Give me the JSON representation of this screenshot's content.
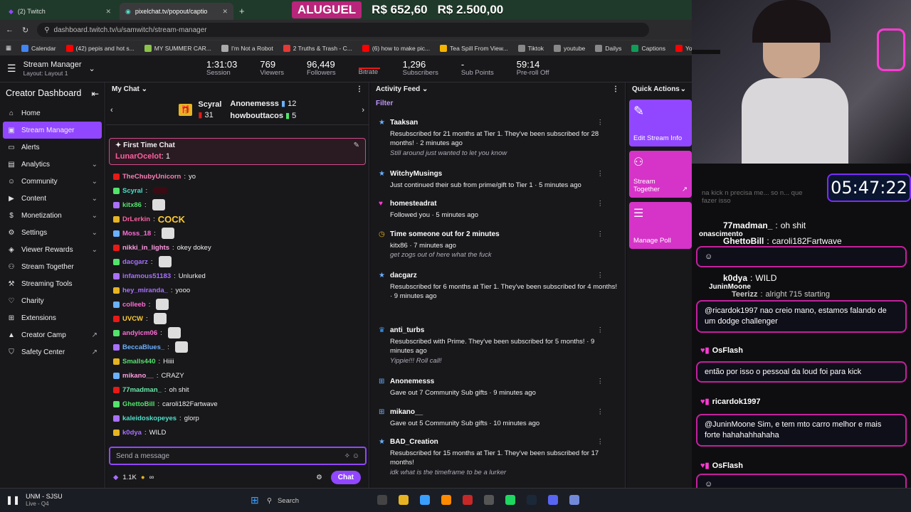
{
  "browser": {
    "tabs": [
      {
        "label": "(2) Twitch"
      },
      {
        "label": "pixelchat.tv/popout/captio"
      }
    ],
    "url": "dashboard.twitch.tv/u/samwitch/stream-manager",
    "bookmarks": [
      "Calendar",
      "(42) pepis and hot s...",
      "MY SUMMER CAR...",
      "I'm Not a Robot",
      "2 Truths & Trash - C...",
      "(6) how to make pic...",
      "Tea Spill From View...",
      "Tiktok",
      "youtube",
      "Dailys",
      "Captions",
      "YouTube"
    ]
  },
  "banner": {
    "tag": "ALUGUEL",
    "price1": "R$ 652,60",
    "price2": "R$ 2.500,00"
  },
  "header": {
    "title": "Stream Manager",
    "layout": "Layout: Layout 1",
    "stats": [
      {
        "value": "1:31:03",
        "label": "Session"
      },
      {
        "value": "769",
        "label": "Viewers"
      },
      {
        "value": "96,449",
        "label": "Followers"
      },
      {
        "value": "",
        "label": "Bitrate"
      },
      {
        "value": "1,296",
        "label": "Subscribers"
      },
      {
        "value": "-",
        "label": "Sub Points"
      },
      {
        "value": "59:14",
        "label": "Pre-roll Off"
      }
    ]
  },
  "sidebar": {
    "title": "Creator Dashboard",
    "items": [
      {
        "label": "Home",
        "icon": "home-icon"
      },
      {
        "label": "Stream Manager",
        "icon": "stream-manager-icon"
      },
      {
        "label": "Alerts",
        "icon": "alerts-icon"
      },
      {
        "label": "Analytics",
        "icon": "analytics-icon"
      },
      {
        "label": "Community",
        "icon": "community-icon"
      },
      {
        "label": "Content",
        "icon": "content-icon"
      },
      {
        "label": "Monetization",
        "icon": "monetization-icon"
      },
      {
        "label": "Settings",
        "icon": "settings-icon"
      },
      {
        "label": "Viewer Rewards",
        "icon": "rewards-icon"
      },
      {
        "label": "Stream Together",
        "icon": "stream-together-icon"
      },
      {
        "label": "Streaming Tools",
        "icon": "tools-icon"
      },
      {
        "label": "Charity",
        "icon": "charity-icon"
      },
      {
        "label": "Extensions",
        "icon": "extensions-icon"
      },
      {
        "label": "Creator Camp",
        "icon": "camp-icon"
      },
      {
        "label": "Safety Center",
        "icon": "shield-icon"
      }
    ]
  },
  "chat": {
    "title": "My Chat",
    "gifters": [
      {
        "name": "Scyral",
        "count": "31"
      },
      {
        "name": "Anonemesss",
        "count": "12"
      },
      {
        "name": "howbouttacos",
        "count": "5"
      }
    ],
    "first_time": {
      "title": "First Time Chat",
      "user": "LunarOcelot",
      "text": "1"
    },
    "messages": [
      {
        "user": "TheChubyUnicorn",
        "color": "#ff7eb6",
        "text": "yo"
      },
      {
        "user": "Scyral",
        "color": "#4ee0c9",
        "text": ""
      },
      {
        "user": "kitx86",
        "color": "#52e36b",
        "text": ""
      },
      {
        "user": "DrLerkin",
        "color": "#ff5ea0",
        "text": "COCK"
      },
      {
        "user": "Moss_18",
        "color": "#ff6ad5",
        "text": ""
      },
      {
        "user": "nikki_in_lights",
        "color": "#ff9be0",
        "text": "okey dokey"
      },
      {
        "user": "dacgarz",
        "color": "#a970ff",
        "text": ""
      },
      {
        "user": "infamous51183",
        "color": "#a970ff",
        "text": "Unlurked"
      },
      {
        "user": "hey_miranda_",
        "color": "#a970ff",
        "text": "yooo"
      },
      {
        "user": "colleeb",
        "color": "#ff6ad5",
        "text": ""
      },
      {
        "user": "UVCW",
        "color": "#ffcc33",
        "text": ""
      },
      {
        "user": "andyicm06",
        "color": "#ff6ad5",
        "text": ""
      },
      {
        "user": "BeccaBlues_",
        "color": "#6ab0ff",
        "text": ""
      },
      {
        "user": "Smalls440",
        "color": "#52e36b",
        "text": "Hiiii"
      },
      {
        "user": "mikano__",
        "color": "#ff9be0",
        "text": "CRAZY"
      },
      {
        "user": "77madman_",
        "color": "#6ae6a8",
        "text": "oh shit"
      },
      {
        "user": "GhettoBill",
        "color": "#52e36b",
        "text": "caroli182Fartwave"
      },
      {
        "user": "kaleidoskopeyes",
        "color": "#4ee0c9",
        "text": "glorp"
      },
      {
        "user": "k0dya",
        "color": "#a970ff",
        "text": "WILD"
      }
    ],
    "input_placeholder": "Send a message",
    "points": "1.1K",
    "infinity": "∞",
    "send_label": "Chat"
  },
  "feed": {
    "title": "Activity Feed",
    "filter": "Filter",
    "items": [
      {
        "user": "Taaksan",
        "line": "Resubscribed for 21 months at Tier 1. They've been subscribed for 28 months! · 2 minutes ago",
        "quote": "Still around just wanted to let you know",
        "icon": "star-icon"
      },
      {
        "user": "WitchyMusings",
        "line": "Just continued their sub from prime/gift to Tier 1 · 5 minutes ago",
        "quote": "",
        "icon": "star-icon"
      },
      {
        "user": "homesteadrat",
        "line": "Followed you · 5 minutes ago",
        "quote": "",
        "icon": "heart-icon"
      },
      {
        "user": "Time someone out for 2 minutes",
        "line": "kitx86 · 7 minutes ago",
        "quote": "get zogs out of here what the fuck",
        "icon": "clock-icon"
      },
      {
        "user": "dacgarz",
        "line": "Resubscribed for 6 months at Tier 1. They've been subscribed for 4 months! · 9 minutes ago",
        "quote": "",
        "icon": "star-icon"
      },
      {
        "user": "anti_turbs",
        "line": "Resubscribed with Prime. They've been subscribed for 5 months! · 9 minutes ago",
        "quote": "Yippie!!! Roll call!",
        "icon": "crown-icon"
      },
      {
        "user": "Anonemesss",
        "line": "Gave out 7 Community Sub gifts · 9 minutes ago",
        "quote": "",
        "icon": "gift-icon"
      },
      {
        "user": "mikano__",
        "line": "Gave out 5 Community Sub gifts · 10 minutes ago",
        "quote": "",
        "icon": "gift-icon"
      },
      {
        "user": "BAD_Creation",
        "line": "Resubscribed for 15 months at Tier 1. They've been subscribed for 17 months!",
        "quote": "idk what is the timeframe to be a lurker",
        "icon": "star-icon"
      }
    ]
  },
  "quick_actions": {
    "title": "Quick Actions",
    "items": [
      {
        "label": "Edit Stream Info",
        "color": "#9147ff"
      },
      {
        "label": "Stream Together",
        "color": "#d633c8"
      },
      {
        "label": "Manage Poll",
        "color": "#d633c8"
      }
    ]
  },
  "overlay": {
    "timer": "05:47:22",
    "faded_text": "na kick n precisa me... so n... que fazer isso",
    "lines": [
      {
        "user": "77madman_",
        "text": "oh shit"
      },
      {
        "user": "onascimento",
        "text": ""
      },
      {
        "user": "GhettoBill",
        "text": "caroli182Fartwave"
      },
      {
        "user": "k0dya",
        "text": "WILD"
      },
      {
        "user": "JuninMoone",
        "text": ""
      },
      {
        "user": "Teerizz",
        "text": "alright 715 starting"
      }
    ],
    "boxes": [
      {
        "user": "",
        "text": "@ricardok1997 nao creio mano, estamos falando de um dodge challenger"
      },
      {
        "user": "OsFlash",
        "text": "então por isso o pessoal da loud foi para kick"
      },
      {
        "user": "ricardok1997",
        "text": "@JuninMoone Sim, e tem mto carro melhor e mais forte hahahahhahaha"
      },
      {
        "user": "OsFlash",
        "text": ""
      }
    ]
  },
  "taskbar": {
    "media_title": "UNM - SJSU",
    "media_sub": "Live - Q4",
    "search": "Search"
  }
}
